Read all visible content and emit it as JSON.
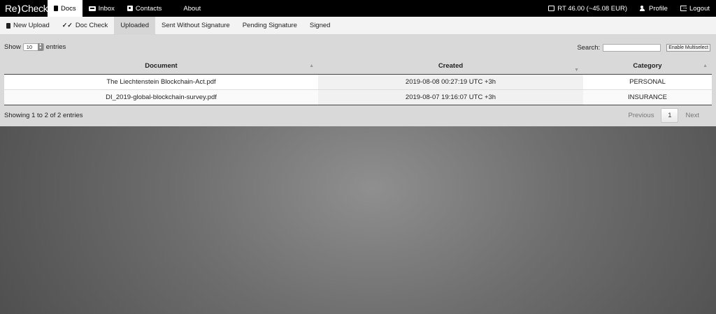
{
  "brand": {
    "left": "Re",
    "right": "Check"
  },
  "nav": {
    "items": [
      {
        "label": "Docs",
        "icon": "document-icon"
      },
      {
        "label": "Inbox",
        "icon": "inbox-icon"
      },
      {
        "label": "Contacts",
        "icon": "contacts-icon"
      },
      {
        "label": "About",
        "icon": "info-icon"
      }
    ],
    "balance": "RT 46.00 (~45.08 EUR)",
    "profile": "Profile",
    "logout": "Logout"
  },
  "tabs": [
    {
      "label": "New Upload",
      "icon": "document-icon"
    },
    {
      "label": "Doc Check",
      "icon": "double-check-icon"
    },
    {
      "label": "Uploaded"
    },
    {
      "label": "Sent Without Signature"
    },
    {
      "label": "Pending Signature"
    },
    {
      "label": "Signed"
    }
  ],
  "controls": {
    "show_label": "Show",
    "page_length": "10",
    "entries_label": "entries",
    "search_label": "Search:",
    "search_value": "",
    "multiselect_label": "Enable Multiselect"
  },
  "table": {
    "columns": [
      "Document",
      "Created",
      "Category"
    ],
    "rows": [
      [
        "The Liechtenstein Blockchain-Act.pdf",
        "2019-08-08 00:27:19 UTC +3h",
        "PERSONAL"
      ],
      [
        "DI_2019-global-blockchain-survey.pdf",
        "2019-08-07 19:16:07 UTC +3h",
        "INSURANCE"
      ]
    ]
  },
  "footer": {
    "info": "Showing 1 to 2 of 2 entries",
    "previous": "Previous",
    "page": "1",
    "next": "Next"
  }
}
